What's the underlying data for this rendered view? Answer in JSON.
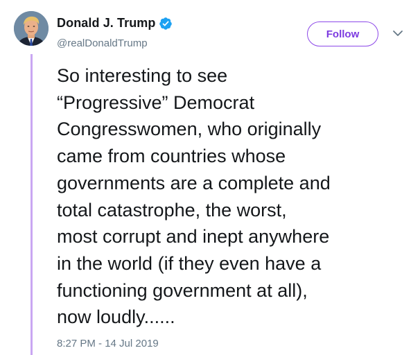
{
  "tweet": {
    "author": {
      "display_name": "Donald J. Trump",
      "handle": "@realDonaldTrump",
      "verified": true,
      "avatar_icon": "profile-photo"
    },
    "follow_label": "Follow",
    "more_icon": "chevron-down-icon",
    "text": "So interesting to see\n“Progressive” Democrat\nCongresswomen, who originally\ncame from countries whose\ngovernments are a complete and\ntotal catastrophe, the worst,\nmost corrupt and inept anywhere\nin the world (if they even have a\nfunctioning government at all),\nnow loudly......",
    "timestamp": "8:27 PM - 14 Jul 2019"
  },
  "colors": {
    "accent": "#7c3ae0",
    "verified_badge": "#1da1f2",
    "thread_line": "#c9a7f2",
    "text": "#14171a",
    "secondary_text": "#657786"
  }
}
